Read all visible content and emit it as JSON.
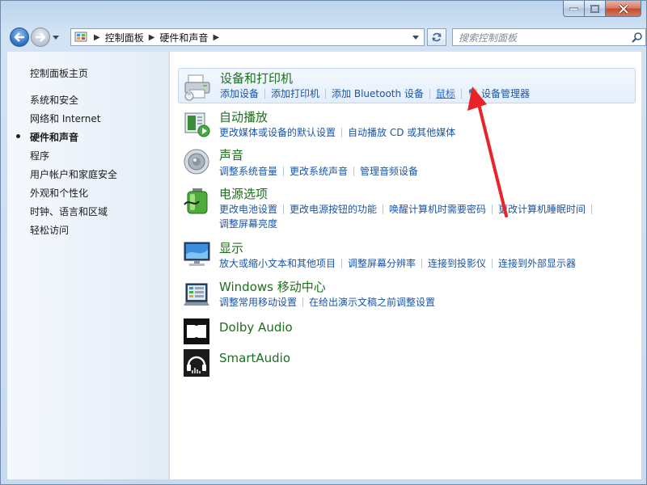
{
  "window": {
    "caption_buttons": [
      "minimize",
      "maximize",
      "close"
    ]
  },
  "navigation": {
    "breadcrumbs": [
      "控制面板",
      "硬件和声音"
    ],
    "search_placeholder": "搜索控制面板"
  },
  "sidebar": {
    "items": [
      {
        "label": "控制面板主页",
        "current": false
      },
      {
        "label": "系统和安全",
        "current": false
      },
      {
        "label": "网络和 Internet",
        "current": false
      },
      {
        "label": "硬件和声音",
        "current": true
      },
      {
        "label": "程序",
        "current": false
      },
      {
        "label": "用户帐户和家庭安全",
        "current": false
      },
      {
        "label": "外观和个性化",
        "current": false
      },
      {
        "label": "时钟、语言和区域",
        "current": false
      },
      {
        "label": "轻松访问",
        "current": false
      }
    ]
  },
  "categories": [
    {
      "id": "devices",
      "title": "设备和打印机",
      "icon": "printer-icon",
      "selected": true,
      "links": [
        "添加设备",
        "添加打印机",
        "添加 Bluetooth 设备",
        "鼠标",
        "设备管理器"
      ]
    },
    {
      "id": "autoplay",
      "title": "自动播放",
      "icon": "autoplay-icon",
      "links": [
        "更改媒体或设备的默认设置",
        "自动播放 CD 或其他媒体"
      ]
    },
    {
      "id": "sound",
      "title": "声音",
      "icon": "speaker-icon",
      "links": [
        "调整系统音量",
        "更改系统声音",
        "管理音频设备"
      ]
    },
    {
      "id": "power",
      "title": "电源选项",
      "icon": "battery-icon",
      "links": [
        "更改电池设置",
        "更改电源按钮的功能",
        "唤醒计算机时需要密码",
        "更改计算机睡眠时间",
        "调整屏幕亮度"
      ]
    },
    {
      "id": "display",
      "title": "显示",
      "icon": "monitor-icon",
      "links": [
        "放大或缩小文本和其他项目",
        "调整屏幕分辨率",
        "连接到投影仪",
        "连接到外部显示器"
      ]
    },
    {
      "id": "mobility",
      "title": "Windows 移动中心",
      "icon": "mobility-center-icon",
      "links": [
        "调整常用移动设置",
        "在给出演示文稿之前调整设置"
      ]
    },
    {
      "id": "dolby",
      "title": "Dolby Audio",
      "icon": "dolby-icon",
      "links": []
    },
    {
      "id": "smartaudio",
      "title": "SmartAudio",
      "icon": "headphones-icon",
      "links": []
    }
  ],
  "annotation": {
    "color": "#e8232a",
    "points_to": "鼠标"
  },
  "colors": {
    "category_title": "#1d6e1d",
    "link": "#1a55a6",
    "sidebar_bg": "#eef4fa"
  }
}
